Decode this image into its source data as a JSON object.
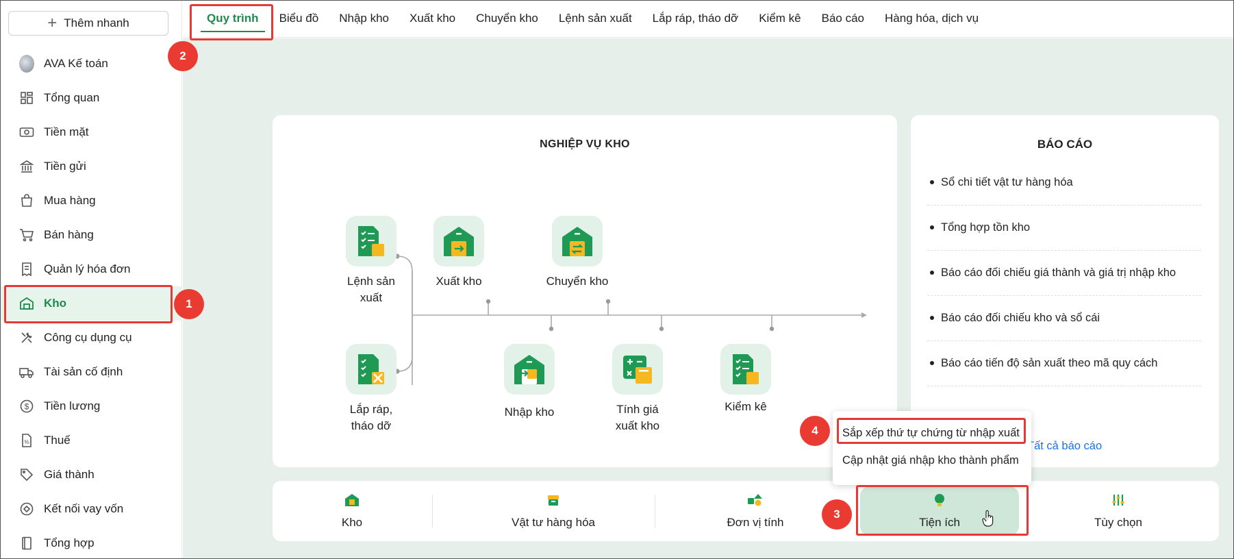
{
  "sidebar": {
    "quick_add_label": "Thêm nhanh",
    "items": [
      {
        "label": "AVA Kế toán",
        "icon": "avatar"
      },
      {
        "label": "Tổng quan",
        "icon": "dashboard-icon"
      },
      {
        "label": "Tiền mặt",
        "icon": "cash-icon"
      },
      {
        "label": "Tiền gửi",
        "icon": "bank-icon"
      },
      {
        "label": "Mua hàng",
        "icon": "shopping-bag-icon"
      },
      {
        "label": "Bán hàng",
        "icon": "cart-icon"
      },
      {
        "label": "Quản lý hóa đơn",
        "icon": "receipt-icon"
      },
      {
        "label": "Kho",
        "icon": "warehouse-icon"
      },
      {
        "label": "Công cụ dụng cụ",
        "icon": "tools-icon"
      },
      {
        "label": "Tài sản cố định",
        "icon": "truck-icon"
      },
      {
        "label": "Tiền lương",
        "icon": "dollar-icon"
      },
      {
        "label": "Thuế",
        "icon": "tax-document-icon"
      },
      {
        "label": "Giá thành",
        "icon": "price-tag-icon"
      },
      {
        "label": "Kết nối vay vốn",
        "icon": "loan-icon"
      },
      {
        "label": "Tổng hợp",
        "icon": "book-icon"
      }
    ]
  },
  "tabs": [
    {
      "label": "Quy trình"
    },
    {
      "label": "Biểu đồ"
    },
    {
      "label": "Nhập kho"
    },
    {
      "label": "Xuất kho"
    },
    {
      "label": "Chuyển kho"
    },
    {
      "label": "Lệnh sản xuất"
    },
    {
      "label": "Lắp ráp, tháo dỡ"
    },
    {
      "label": "Kiểm kê"
    },
    {
      "label": "Báo cáo"
    },
    {
      "label": "Hàng hóa, dịch vụ"
    }
  ],
  "process": {
    "title": "NGHIỆP VỤ KHO",
    "nodes": {
      "production_order": "Lệnh sản xuất",
      "assembly": "Lắp ráp, tháo dỡ",
      "stock_out": "Xuất kho",
      "transfer": "Chuyển kho",
      "stock_in": "Nhập kho",
      "costing": "Tính giá xuất kho",
      "inventory_check": "Kiểm kê"
    }
  },
  "reports": {
    "title": "BÁO CÁO",
    "items": [
      "Sổ chi tiết vật tư hàng hóa",
      "Tổng hợp tồn kho",
      "Báo cáo đối chiếu giá thành và giá trị nhập kho",
      "Báo cáo đối chiếu kho và sổ cái",
      "Báo cáo tiến độ sản xuất theo mã quy cách"
    ],
    "all_link_visible": "Tất cả báo cáo"
  },
  "bottom_bar": [
    {
      "label": "Kho",
      "icon": "warehouse-icon"
    },
    {
      "label": "Vật tư hàng hóa",
      "icon": "goods-box-icon"
    },
    {
      "label": "Đơn vị tính",
      "icon": "units-icon"
    },
    {
      "label": "Tiện ích",
      "icon": "lightbulb-icon"
    },
    {
      "label": "Tùy chọn",
      "icon": "sliders-icon"
    }
  ],
  "popup_menu": [
    "Sắp xếp thứ tự chứng từ nhập xuất",
    "Cập nhật giá nhập kho thành phẩm"
  ],
  "annotations": [
    "1",
    "2",
    "3",
    "4"
  ],
  "colors": {
    "brand_green": "#1e8a4c",
    "icon_green": "#1e9a55",
    "icon_yellow": "#f5b821",
    "background": "#e6efea",
    "annotation_red": "#e53935",
    "link_blue": "#1a73e8"
  }
}
